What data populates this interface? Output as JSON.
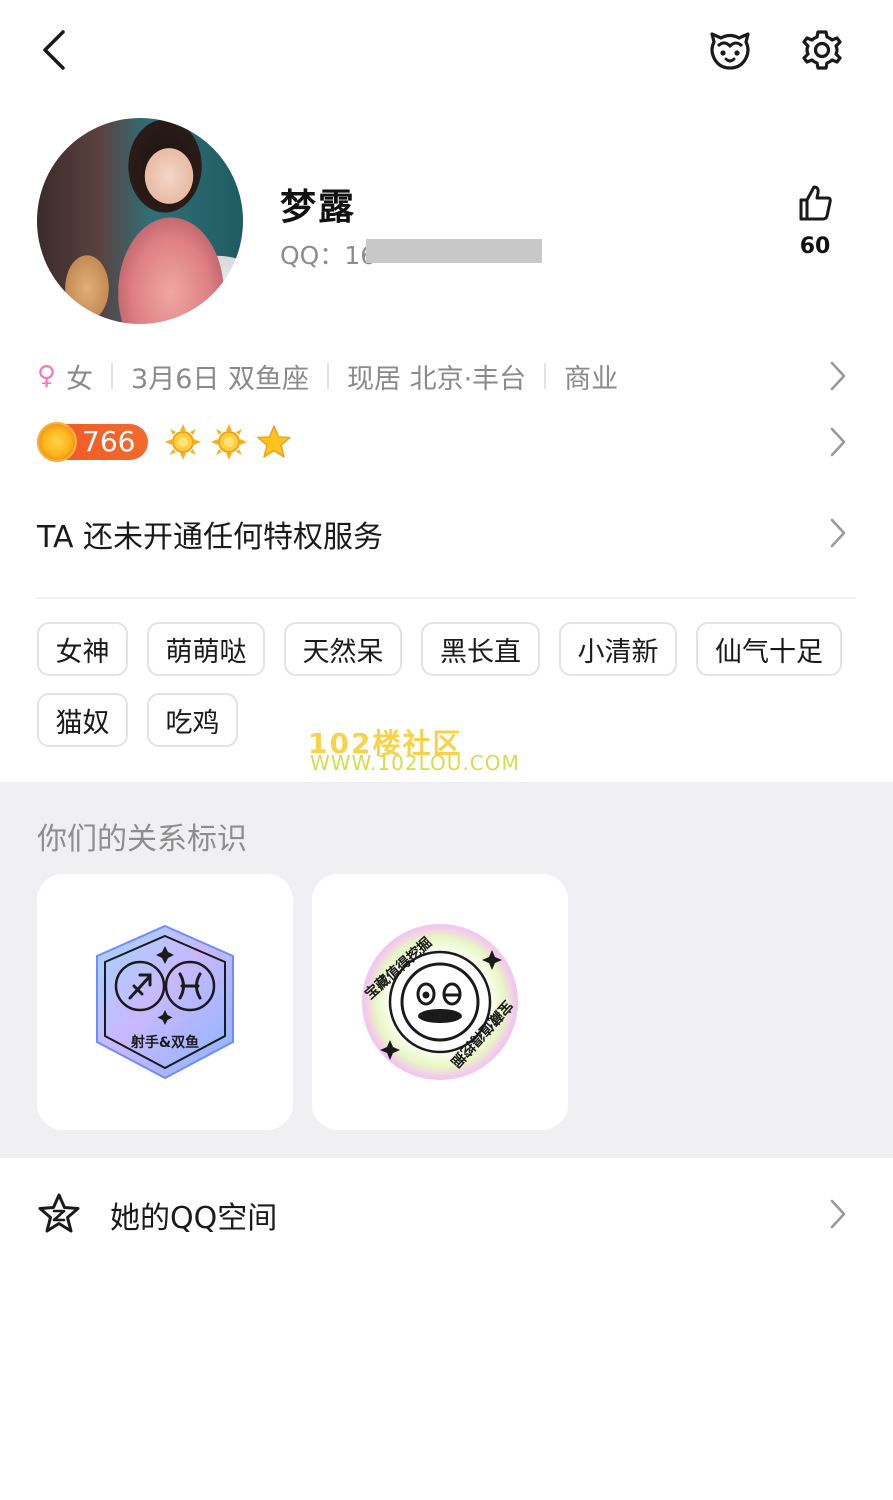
{
  "header": {
    "back_icon": "chevron-left-icon",
    "pet_icon": "pet-face-icon",
    "settings_icon": "gear-icon"
  },
  "profile": {
    "name": "梦露",
    "qq_label": "QQ：1",
    "qq_partial": "6",
    "likes": "60"
  },
  "info": {
    "gender_symbol": "♀",
    "gender": "女",
    "birthday": "3月6日 双鱼座",
    "location": "现居 北京·丰台",
    "industry": "商业",
    "gender_color": "#f17ac0"
  },
  "level": {
    "value": "766",
    "icons": [
      "sun-icon",
      "sun-icon",
      "star-icon"
    ]
  },
  "privilege": {
    "text": "TA 还未开通任何特权服务"
  },
  "tags": [
    "女神",
    "萌萌哒",
    "天然呆",
    "黑长直",
    "小清新",
    "仙气十足",
    "猫奴",
    "吃鸡"
  ],
  "watermark": {
    "line1": "102楼社区",
    "line2": "WWW.102LOU.COM"
  },
  "relation": {
    "title": "你们的关系标识",
    "badges": [
      {
        "label": "射手&双鱼",
        "icon": "zodiac-hexagon-icon"
      },
      {
        "label": "宝藏值得挖掘",
        "icon": "treasure-face-icon"
      }
    ]
  },
  "qzone": {
    "label": "她的QQ空间",
    "icon": "qzone-star-icon"
  }
}
